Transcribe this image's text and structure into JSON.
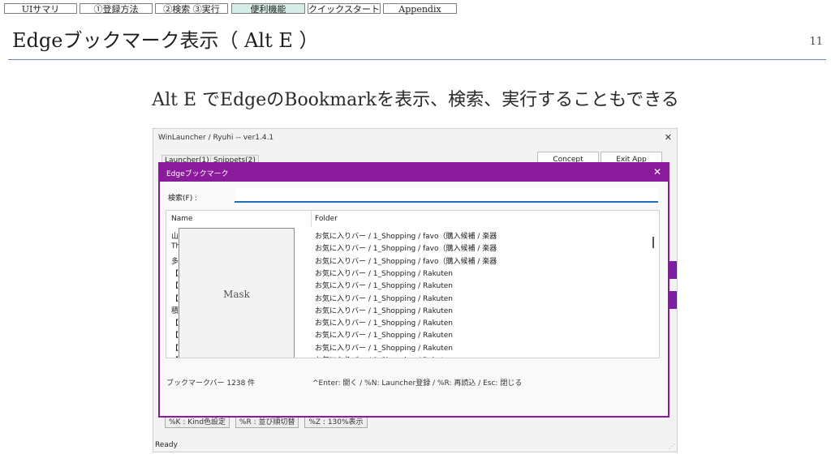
{
  "nav": {
    "tabs": [
      "UIサマリ",
      "①登録方法",
      "②検索 ③実行",
      "便利機能",
      "クイックスタート",
      "Appendix"
    ],
    "active_index": 3
  },
  "slide": {
    "title": "Edgeブックマーク表示（ Alt E ）",
    "page_number": "11",
    "subtitle": "Alt E でEdgeのBookmarkを表示、検索、実行することもできる"
  },
  "app": {
    "title": "WinLauncher / Ryuhi -- ver1.4.1",
    "tabs": [
      "Launcher(1)",
      "Snippets(2)"
    ],
    "buttons": [
      "Concept",
      "Exit App"
    ],
    "bottom_shortcuts": [
      "%K : Kind色設定",
      "%R : 並び順切替",
      "%Z : 130%表示"
    ],
    "status": "Ready",
    "accent_color": "#7b1fa2"
  },
  "dialog": {
    "title": "Edgeブックマーク",
    "close_glyph": "✕",
    "search_label": "検索(F) :",
    "search_value": "",
    "columns": {
      "name": "Name",
      "folder": "Folder"
    },
    "rows": [
      {
        "name": "山",
        "folder": "お気に入りバー / 1_Shopping / favo（購入候補 / 楽器"
      },
      {
        "name": "Th",
        "folder": "お気に入りバー / 1_Shopping / favo（購入候補 / 楽器"
      },
      {
        "name": "多",
        "folder": "お気に入りバー / 1_Shopping / favo（購入候補 / 楽器"
      },
      {
        "name": "【楽",
        "folder": "お気に入りバー / 1_Shopping / Rakuten"
      },
      {
        "name": "【楽",
        "folder": "お気に入りバー / 1_Shopping / Rakuten"
      },
      {
        "name": "【楽",
        "folder": "お気に入りバー / 1_Shopping / Rakuten"
      },
      {
        "name": "積",
        "folder": "お気に入りバー / 1_Shopping / Rakuten"
      },
      {
        "name": "【楽",
        "folder": "お気に入りバー / 1_Shopping / Rakuten"
      },
      {
        "name": "【楽",
        "folder": "お気に入りバー / 1_Shopping / Rakuten"
      },
      {
        "name": "【楽",
        "folder": "お気に入りバー / 1_Shopping / Rakuten"
      },
      {
        "name": "【楽",
        "folder": "お気に入りバー / 1_Shopping / Rakuten"
      }
    ],
    "mask_label": "Mask",
    "footer_count": "ブックマークバー 1238 件",
    "footer_keys": "^Enter: 開く / %N: Launcher登録 / %R: 再読込 / Esc: 閉じる",
    "accent_color": "#8a1c9b",
    "focus_color": "#1e6fc4"
  }
}
